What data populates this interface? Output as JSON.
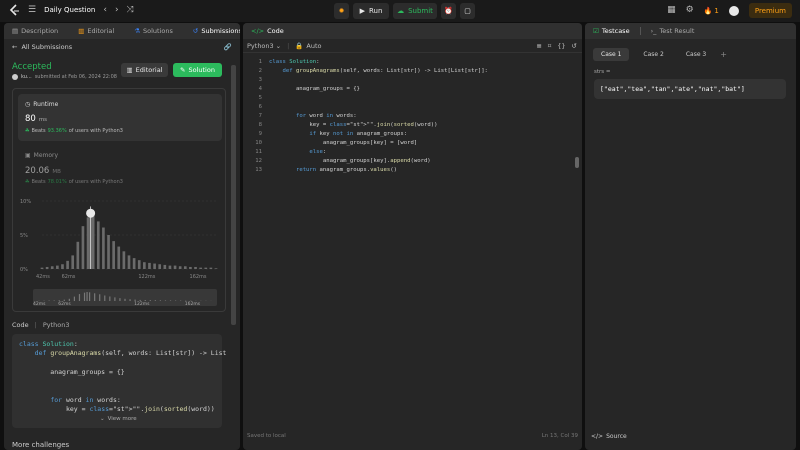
{
  "topbar": {
    "problem_list_label": "Daily Question",
    "run_label": "Run",
    "submit_label": "Submit",
    "streak_count": "1",
    "premium_label": "Premium"
  },
  "left": {
    "tabs": [
      {
        "label": "Description",
        "active": false
      },
      {
        "label": "Editorial",
        "active": false
      },
      {
        "label": "Solutions",
        "active": false
      },
      {
        "label": "Submissions",
        "active": true
      }
    ],
    "all_submissions_label": "All Submissions",
    "status": "Accepted",
    "user_name": "ku...",
    "submitted_at": "submitted at Feb 06, 2024 22:08",
    "editorial_button": "Editorial",
    "solution_button": "Solution",
    "runtime": {
      "label": "Runtime",
      "value": "80",
      "unit": "ms",
      "beats_prefix": "Beats",
      "beats_pct": "93.36%",
      "beats_suffix": "of users with Python3"
    },
    "memory": {
      "label": "Memory",
      "value": "20.06",
      "unit": "MB",
      "beats_prefix": "Beats",
      "beats_pct": "78.01%",
      "beats_suffix": "of users with Python3"
    },
    "code_label": "Code",
    "code_lang": "Python3",
    "code_lines": [
      "class Solution:",
      "    def groupAnagrams(self, words: List[str]) -> List",
      "",
      "        anagram_groups = {}",
      "",
      "",
      "        for word in words:",
      "            key = \"\".join(sorted(word))"
    ],
    "view_more_label": "View more",
    "more_challenges_label": "More challenges"
  },
  "chart_data": {
    "type": "bar",
    "x_ticks": [
      "42ms",
      "62ms",
      "122ms",
      "162ms"
    ],
    "y_ticks": [
      "10%",
      "5%",
      "0%"
    ],
    "ylim": [
      0,
      10
    ],
    "your_runtime_ms": 80,
    "x": [
      42,
      46,
      50,
      54,
      58,
      62,
      66,
      70,
      74,
      78,
      80,
      82,
      86,
      90,
      94,
      98,
      102,
      106,
      110,
      114,
      118,
      122,
      126,
      130,
      134,
      138,
      142,
      146,
      150,
      154,
      158,
      162,
      166,
      170,
      174,
      178
    ],
    "values": [
      0.2,
      0.3,
      0.4,
      0.5,
      0.7,
      1.2,
      2.0,
      4.0,
      6.3,
      7.6,
      8.2,
      7.9,
      7.0,
      6.1,
      5.0,
      4.1,
      3.3,
      2.6,
      2.0,
      1.6,
      1.3,
      1.0,
      0.9,
      0.8,
      0.7,
      0.6,
      0.5,
      0.5,
      0.4,
      0.4,
      0.3,
      0.3,
      0.2,
      0.2,
      0.2,
      0.1
    ],
    "mini_x_ticks": [
      "42ms",
      "62ms",
      "122ms",
      "162ms"
    ]
  },
  "middle": {
    "title": "Code",
    "language": "Python3",
    "auto_label": "Auto",
    "lines": [
      "class Solution:",
      "    def groupAnagrams(self, words: List[str]) -> List[List[str]]:",
      "",
      "        anagram_groups = {}",
      "",
      "",
      "        for word in words:",
      "            key = \"\".join(sorted(word))",
      "            if key not in anagram_groups:",
      "                anagram_groups[key] = [word]",
      "            else:",
      "                anagram_groups[key].append(word)",
      "        return anagram_groups.values()"
    ],
    "saved_label": "Saved to local",
    "cursor_pos": "Ln 13, Col 39"
  },
  "right": {
    "tabs": [
      {
        "label": "Testcase",
        "active": true
      },
      {
        "label": "Test Result",
        "active": false
      }
    ],
    "cases": [
      "Case 1",
      "Case 2",
      "Case 3"
    ],
    "add_label": "+",
    "var_label": "strs =",
    "input_value": "[\"eat\",\"tea\",\"tan\",\"ate\",\"nat\",\"bat\"]",
    "source_label": "Source"
  }
}
